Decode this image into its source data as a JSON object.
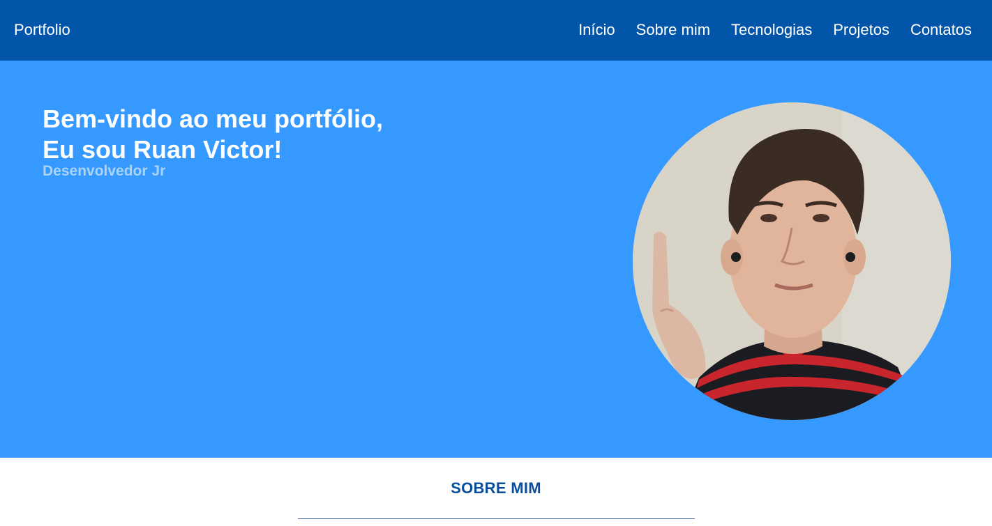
{
  "header": {
    "brand": "Portfolio",
    "nav": [
      {
        "label": "Início"
      },
      {
        "label": "Sobre mim"
      },
      {
        "label": "Tecnologias"
      },
      {
        "label": "Projetos"
      },
      {
        "label": "Contatos"
      }
    ]
  },
  "hero": {
    "title_line1": "Bem-vindo ao meu portfólio,",
    "title_line2": "Eu sou Ruan Victor!",
    "subtitle": "Desenvolvedor Jr",
    "photo_icon": "profile-photo"
  },
  "about": {
    "title": "SOBRE MIM"
  },
  "colors": {
    "header_bg": "#0255a9",
    "hero_bg": "#3599ff",
    "subtitle": "#a9d3f7",
    "section_title": "#0a4e9c"
  }
}
